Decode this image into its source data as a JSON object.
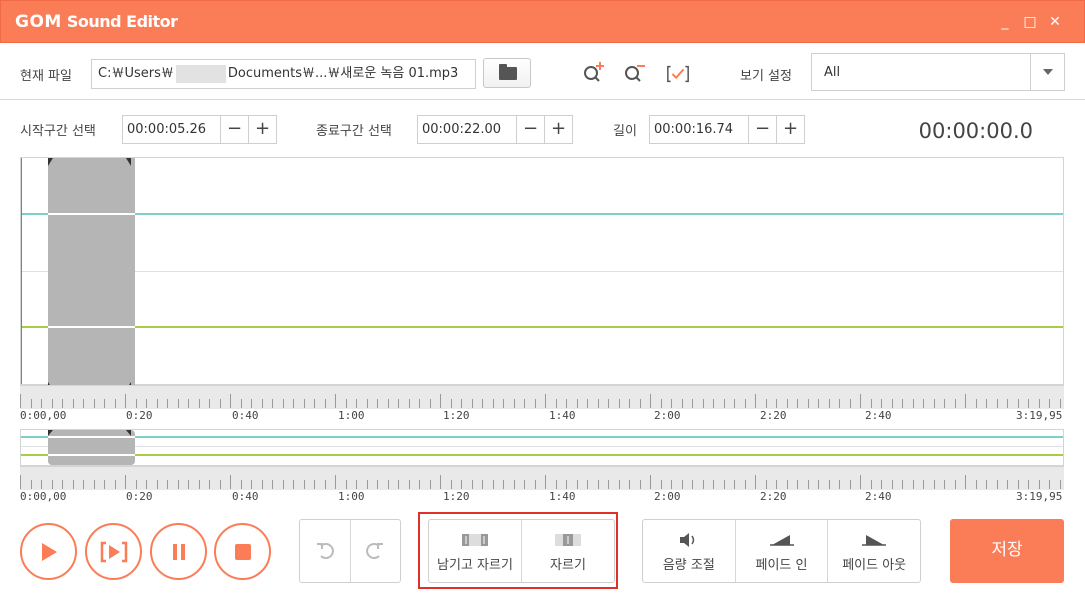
{
  "window": {
    "brand": "GOM",
    "title": "Sound Editor",
    "minimize": "_",
    "maximize": "□",
    "close": "✕"
  },
  "file": {
    "label": "현재 파일",
    "path_prefix": "C:￦Users￦",
    "path_suffix": "Documents￦...￦새로운 녹음 01.mp3"
  },
  "toolbar": {
    "zoom_in_icon": "zoom-in-icon",
    "zoom_out_icon": "zoom-out-icon",
    "fit_icon": "check-bracket-icon"
  },
  "view": {
    "label": "보기 설정",
    "value": "All"
  },
  "range": {
    "start_label": "시작구간 선택",
    "start_value": "00:00:05.26",
    "end_label": "종료구간 선택",
    "end_value": "00:00:22.00",
    "length_label": "길이",
    "length_value": "00:00:16.74",
    "minus": "−",
    "plus": "+"
  },
  "timer": "00:00:00.0",
  "timeline": {
    "labels": [
      "0:00,00",
      "0:20",
      "0:40",
      "1:00",
      "1:20",
      "1:40",
      "2:00",
      "2:20",
      "2:40",
      "3:19,95"
    ]
  },
  "controls": {
    "play": "play-icon",
    "play_selection": "play-selection-icon",
    "pause": "pause-icon",
    "stop": "stop-icon",
    "undo": "undo-icon",
    "redo": "redo-icon"
  },
  "edit": {
    "trim_label": "남기고 자르기",
    "cut_label": "자르기"
  },
  "effects": {
    "volume_label": "음량 조절",
    "fade_in_label": "페이드 인",
    "fade_out_label": "페이드 아웃"
  },
  "save_label": "저장",
  "colors": {
    "accent": "#fb7d58",
    "channel1": "#7fcfc9",
    "channel2": "#a9cc47",
    "highlight": "#e0302b"
  }
}
